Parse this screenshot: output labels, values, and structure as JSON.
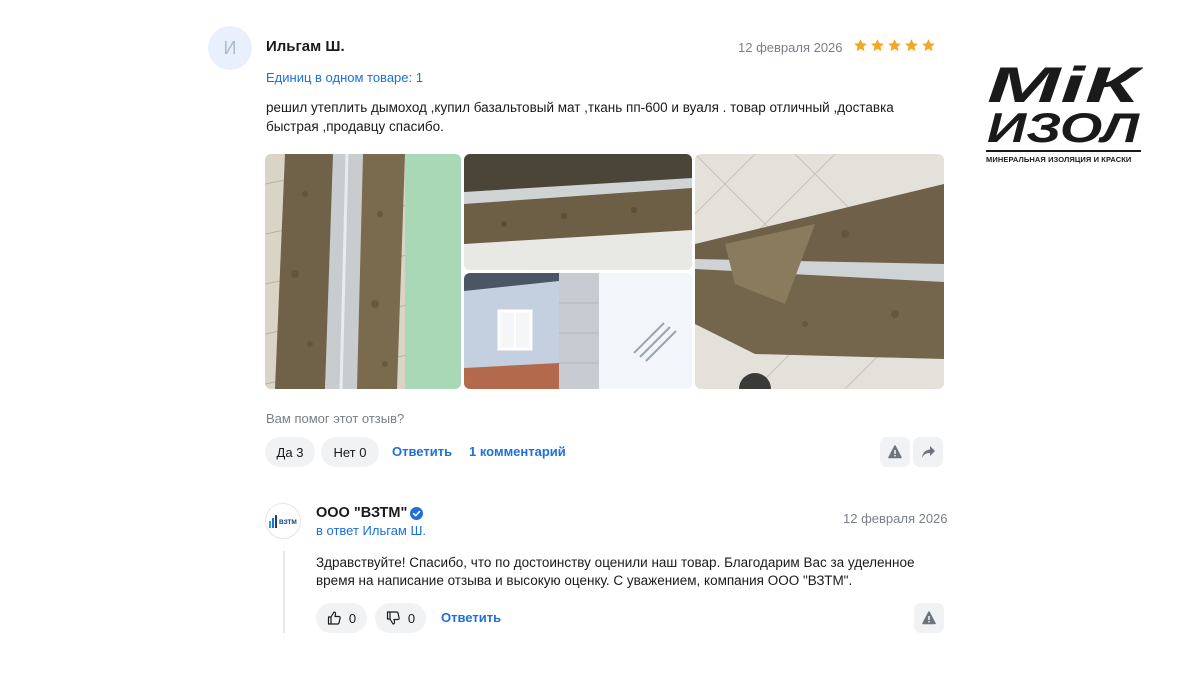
{
  "review": {
    "avatar_letter": "И",
    "author": "Ильгам Ш.",
    "date": "12 февраля 2026",
    "rating": 5,
    "units": "Единиц в одном товаре: 1",
    "text": "решил утеплить дымоход ,купил базальтовый мат ,ткань пп-600 и вуаля . товар отличный ,доставка быстрая ,продавцу спасибо.",
    "photos": [
      "pipe-insulation-photo-1",
      "pipe-insulation-photo-2",
      "chimney-outdoor-photo",
      "pipe-insulation-photo-3"
    ],
    "helpful_question": "Вам помог этот отзыв?",
    "yes_label": "Да 3",
    "no_label": "Нет 0",
    "reply_label": "Ответить",
    "comments_label": "1 комментарий"
  },
  "seller_reply": {
    "name": "ООО \"ВЗТМ\"",
    "in_reply_to": "в ответ Ильгам Ш.",
    "date": "12 февраля 2026",
    "text": "Здравствуйте! Спасибо, что по достоинству оценили наш товар. Благодарим Вас за уделенное время на написание отзыва и высокую оценку. С уважением, компания ООО \"ВЗТМ\".",
    "likes": "0",
    "dislikes": "0",
    "reply_label": "Ответить",
    "avatar_text": "ВЗТМ"
  },
  "brand": {
    "logo_top": "МiК",
    "logo_bottom": "ИЗОЛ",
    "caption": "МИНЕРАЛЬНАЯ ИЗОЛЯЦИЯ И КРАСКИ"
  },
  "colors": {
    "accent": "#1e6fd9",
    "star": "#f5a623",
    "muted": "#7a7f87",
    "pill_bg": "#f1f2f4"
  }
}
